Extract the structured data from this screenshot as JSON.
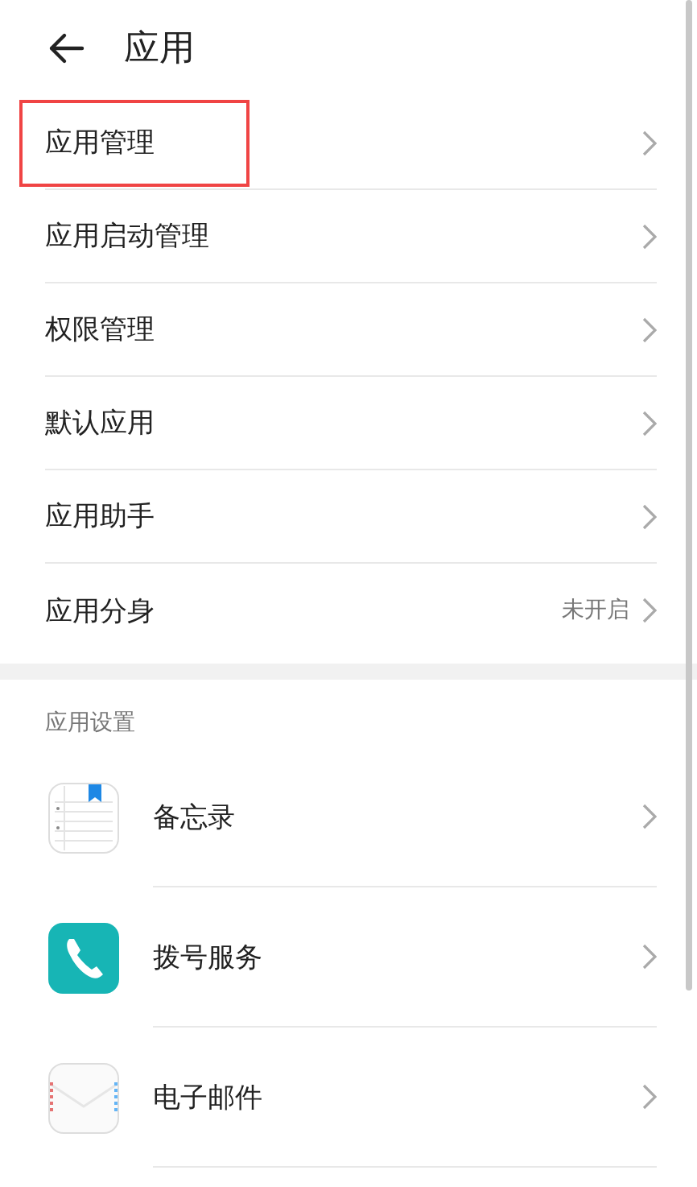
{
  "header": {
    "title": "应用"
  },
  "menu": [
    {
      "label": "应用管理",
      "highlighted": true
    },
    {
      "label": "应用启动管理",
      "highlighted": false
    },
    {
      "label": "权限管理",
      "highlighted": false
    },
    {
      "label": "默认应用",
      "highlighted": false
    },
    {
      "label": "应用助手",
      "highlighted": false
    },
    {
      "label": "应用分身",
      "highlighted": false,
      "value": "未开启"
    }
  ],
  "section": {
    "title": "应用设置"
  },
  "apps": [
    {
      "label": "备忘录",
      "kind": "notes"
    },
    {
      "label": "拨号服务",
      "kind": "phone"
    },
    {
      "label": "电子邮件",
      "kind": "mail"
    }
  ]
}
